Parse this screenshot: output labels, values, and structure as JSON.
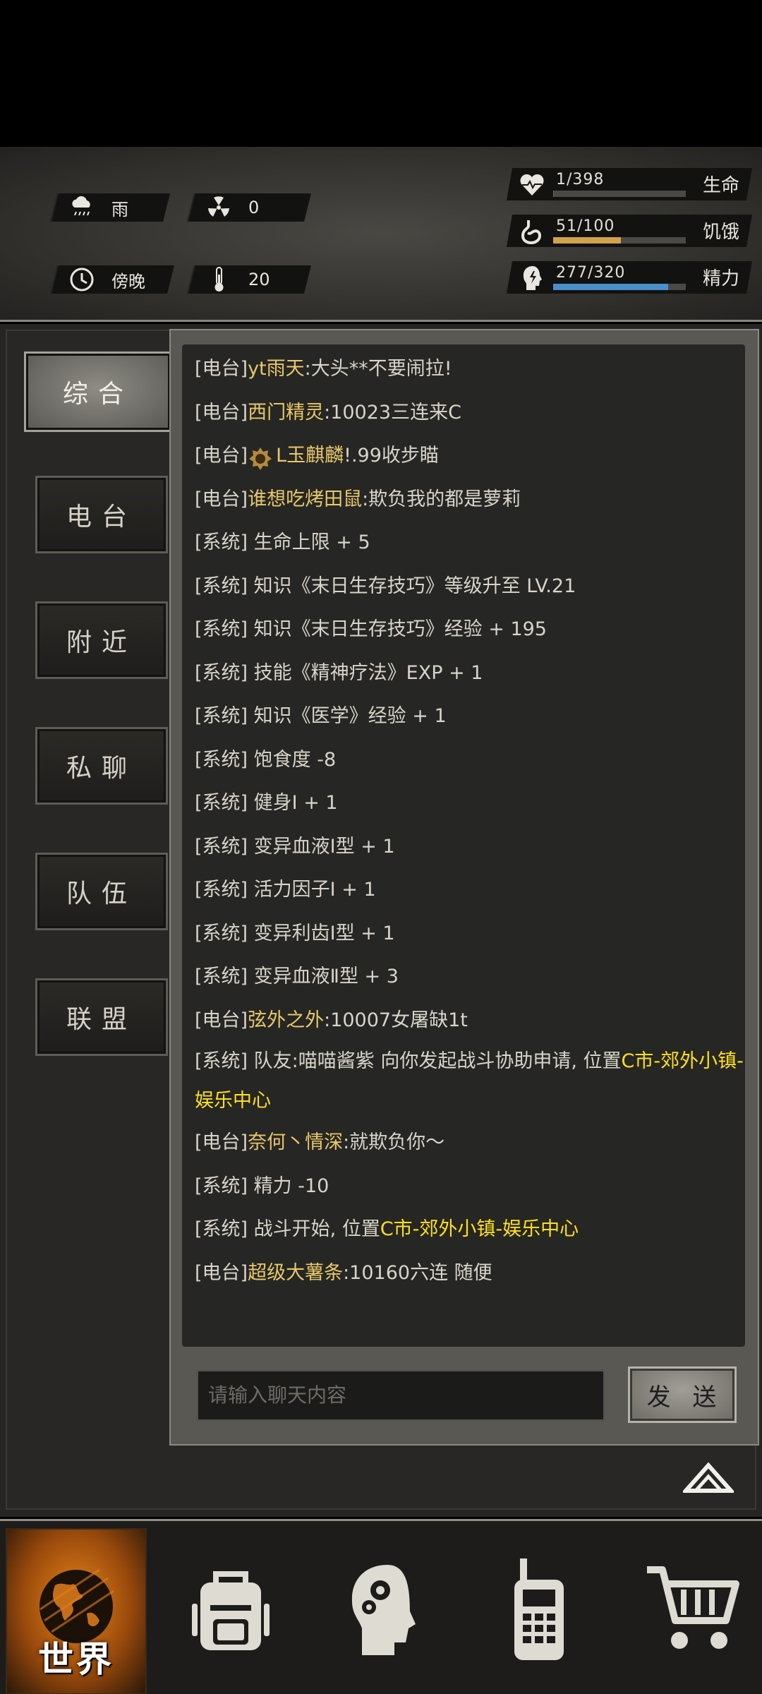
{
  "status": {
    "weather": {
      "value": "雨",
      "icon": "rain-cloud-icon"
    },
    "radiation": {
      "value": "0",
      "icon": "radiation-icon"
    },
    "time_of_day": {
      "value": "傍晚",
      "icon": "clock-icon"
    },
    "temperature": {
      "value": "20",
      "icon": "thermometer-icon"
    },
    "bars": [
      {
        "name": "生命",
        "value": "1/398",
        "fraction": 0.0025,
        "color": "#6f6e6a",
        "icon": "heart-pulse-icon"
      },
      {
        "name": "饥饿",
        "value": "51/100",
        "fraction": 0.51,
        "color": "#d2a24b",
        "icon": "stomach-icon"
      },
      {
        "name": "精力",
        "value": "277/320",
        "fraction": 0.866,
        "color": "#4b8ec9",
        "icon": "energy-head-icon"
      }
    ]
  },
  "tabs": [
    {
      "label": "综合",
      "active": true
    },
    {
      "label": "电台",
      "active": false
    },
    {
      "label": "附近",
      "active": false
    },
    {
      "label": "私聊",
      "active": false
    },
    {
      "label": "队伍",
      "active": false
    },
    {
      "label": "联盟",
      "active": false
    }
  ],
  "chat": {
    "messages": [
      {
        "channel": "[电台]",
        "user": "yt雨天",
        "text": ":大头**不要闹拉!"
      },
      {
        "channel": "[电台]",
        "user": "西门精灵",
        "text": ":10023三连来C"
      },
      {
        "channel": "[电台]",
        "user": "L玉麒麟",
        "text": "!.99收步瞄",
        "badge": true
      },
      {
        "channel": "[电台]",
        "user": "谁想吃烤田鼠",
        "text": ":欺负我的都是萝莉"
      },
      {
        "channel": "[系统]",
        "user": "",
        "text": "生命上限 + 5"
      },
      {
        "channel": "[系统]",
        "user": "",
        "text": "知识《末日生存技巧》等级升至 LV.21"
      },
      {
        "channel": "[系统]",
        "user": "",
        "text": "知识《末日生存技巧》经验 + 195"
      },
      {
        "channel": "[系统]",
        "user": "",
        "text": "技能《精神疗法》EXP + 1"
      },
      {
        "channel": "[系统]",
        "user": "",
        "text": "知识《医学》经验 + 1"
      },
      {
        "channel": "[系统]",
        "user": "",
        "text": "饱食度 -8"
      },
      {
        "channel": "[系统]",
        "user": "",
        "text": "健身Ⅰ + 1"
      },
      {
        "channel": "[系统]",
        "user": "",
        "text": "变异血液Ⅰ型 + 1"
      },
      {
        "channel": "[系统]",
        "user": "",
        "text": "活力因子Ⅰ + 1"
      },
      {
        "channel": "[系统]",
        "user": "",
        "text": "变异利齿Ⅰ型 + 1"
      },
      {
        "channel": "[系统]",
        "user": "",
        "text": "变异血液Ⅱ型 + 3"
      },
      {
        "channel": "[电台]",
        "user": "弦外之外",
        "text": ":10007女屠缺1t"
      },
      {
        "channel": "[系统]",
        "user": "",
        "text": "队友:喵喵酱紫 向你发起战斗协助申请, 位置",
        "location": "C市-郊外小镇-娱乐中心",
        "wrap": true
      },
      {
        "channel": "[电台]",
        "user": "奈何丶情深",
        "text": ":就欺负你～"
      },
      {
        "channel": "[系统]",
        "user": "",
        "text": "精力 -10"
      },
      {
        "channel": "[系统]",
        "user": "",
        "text": "战斗开始, 位置",
        "location": "C市-郊外小镇-娱乐中心"
      },
      {
        "channel": "[电台]",
        "user": "超级大薯条",
        "text": ":10160六连 随便"
      }
    ],
    "input_placeholder": "请输入聊天内容",
    "send_label": "发 送"
  },
  "nav": [
    {
      "label": "世界",
      "icon": "globe-icon",
      "active": true
    },
    {
      "label": "",
      "icon": "backpack-icon"
    },
    {
      "label": "",
      "icon": "skills-head-icon"
    },
    {
      "label": "",
      "icon": "walkie-talkie-icon"
    },
    {
      "label": "",
      "icon": "shopping-cart-icon"
    }
  ]
}
